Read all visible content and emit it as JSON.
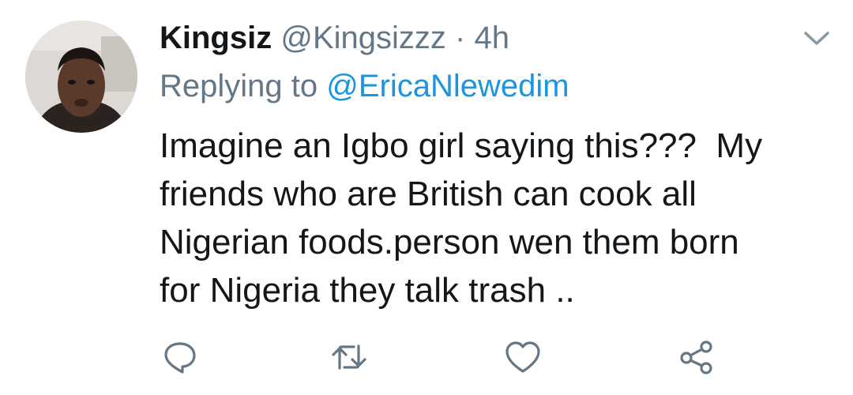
{
  "tweet": {
    "display_name": "Kingsiz",
    "handle": "@Kingsizzz",
    "separator": "·",
    "timestamp": "4h",
    "reply_prefix": "Replying to",
    "reply_to": "@EricaNlewedim",
    "body_lines": [
      "Imagine an Igbo girl saying this???  My",
      "friends who are British can cook all",
      "Nigerian foods.person wen them born",
      "for Nigeria they talk trash .."
    ]
  },
  "icons": {
    "menu": "chevron-down-icon",
    "reply": "reply-icon",
    "retweet": "retweet-icon",
    "like": "heart-icon",
    "share": "share-icon"
  },
  "colors": {
    "text": "#14171a",
    "secondary": "#657786",
    "link": "#1b95e0",
    "icon": "#657786"
  }
}
